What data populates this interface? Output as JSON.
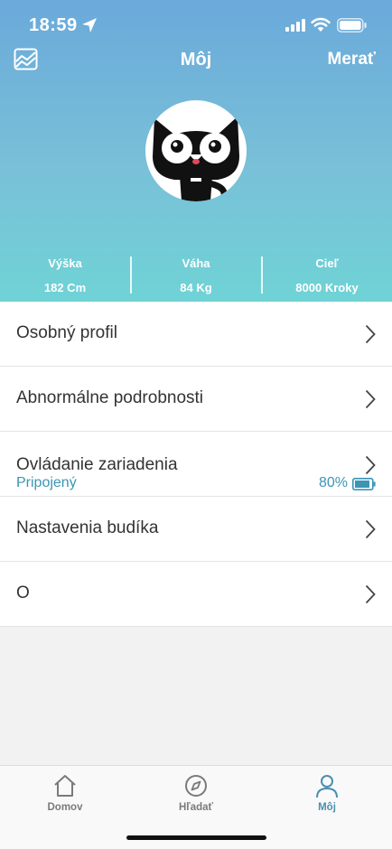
{
  "status_bar": {
    "time": "18:59"
  },
  "header": {
    "title": "Môj",
    "measure_label": "Merať",
    "chart_icon": "chart-icon"
  },
  "stats": [
    {
      "label": "Výška",
      "value": "182 Cm"
    },
    {
      "label": "Váha",
      "value": "84 Kg"
    },
    {
      "label": "Cieľ",
      "value": "8000 Kroky"
    }
  ],
  "menu": {
    "items": [
      {
        "label": "Osobný profil"
      },
      {
        "label": "Abnormálne podrobnosti"
      },
      {
        "label": "Ovládanie zariadenia",
        "status": "Pripojený",
        "battery": "80%"
      },
      {
        "label": "Nastavenia budíka"
      },
      {
        "label": "O"
      }
    ]
  },
  "tabs": [
    {
      "label": "Domov",
      "icon": "home-icon"
    },
    {
      "label": "Hľadať",
      "icon": "compass-icon"
    },
    {
      "label": "Môj",
      "icon": "person-icon",
      "active": true
    }
  ],
  "colors": {
    "header_top": "#6aa9da",
    "header_bottom": "#6fd3d6",
    "accent": "#3b95b4",
    "tab_active": "#4a8fae"
  }
}
